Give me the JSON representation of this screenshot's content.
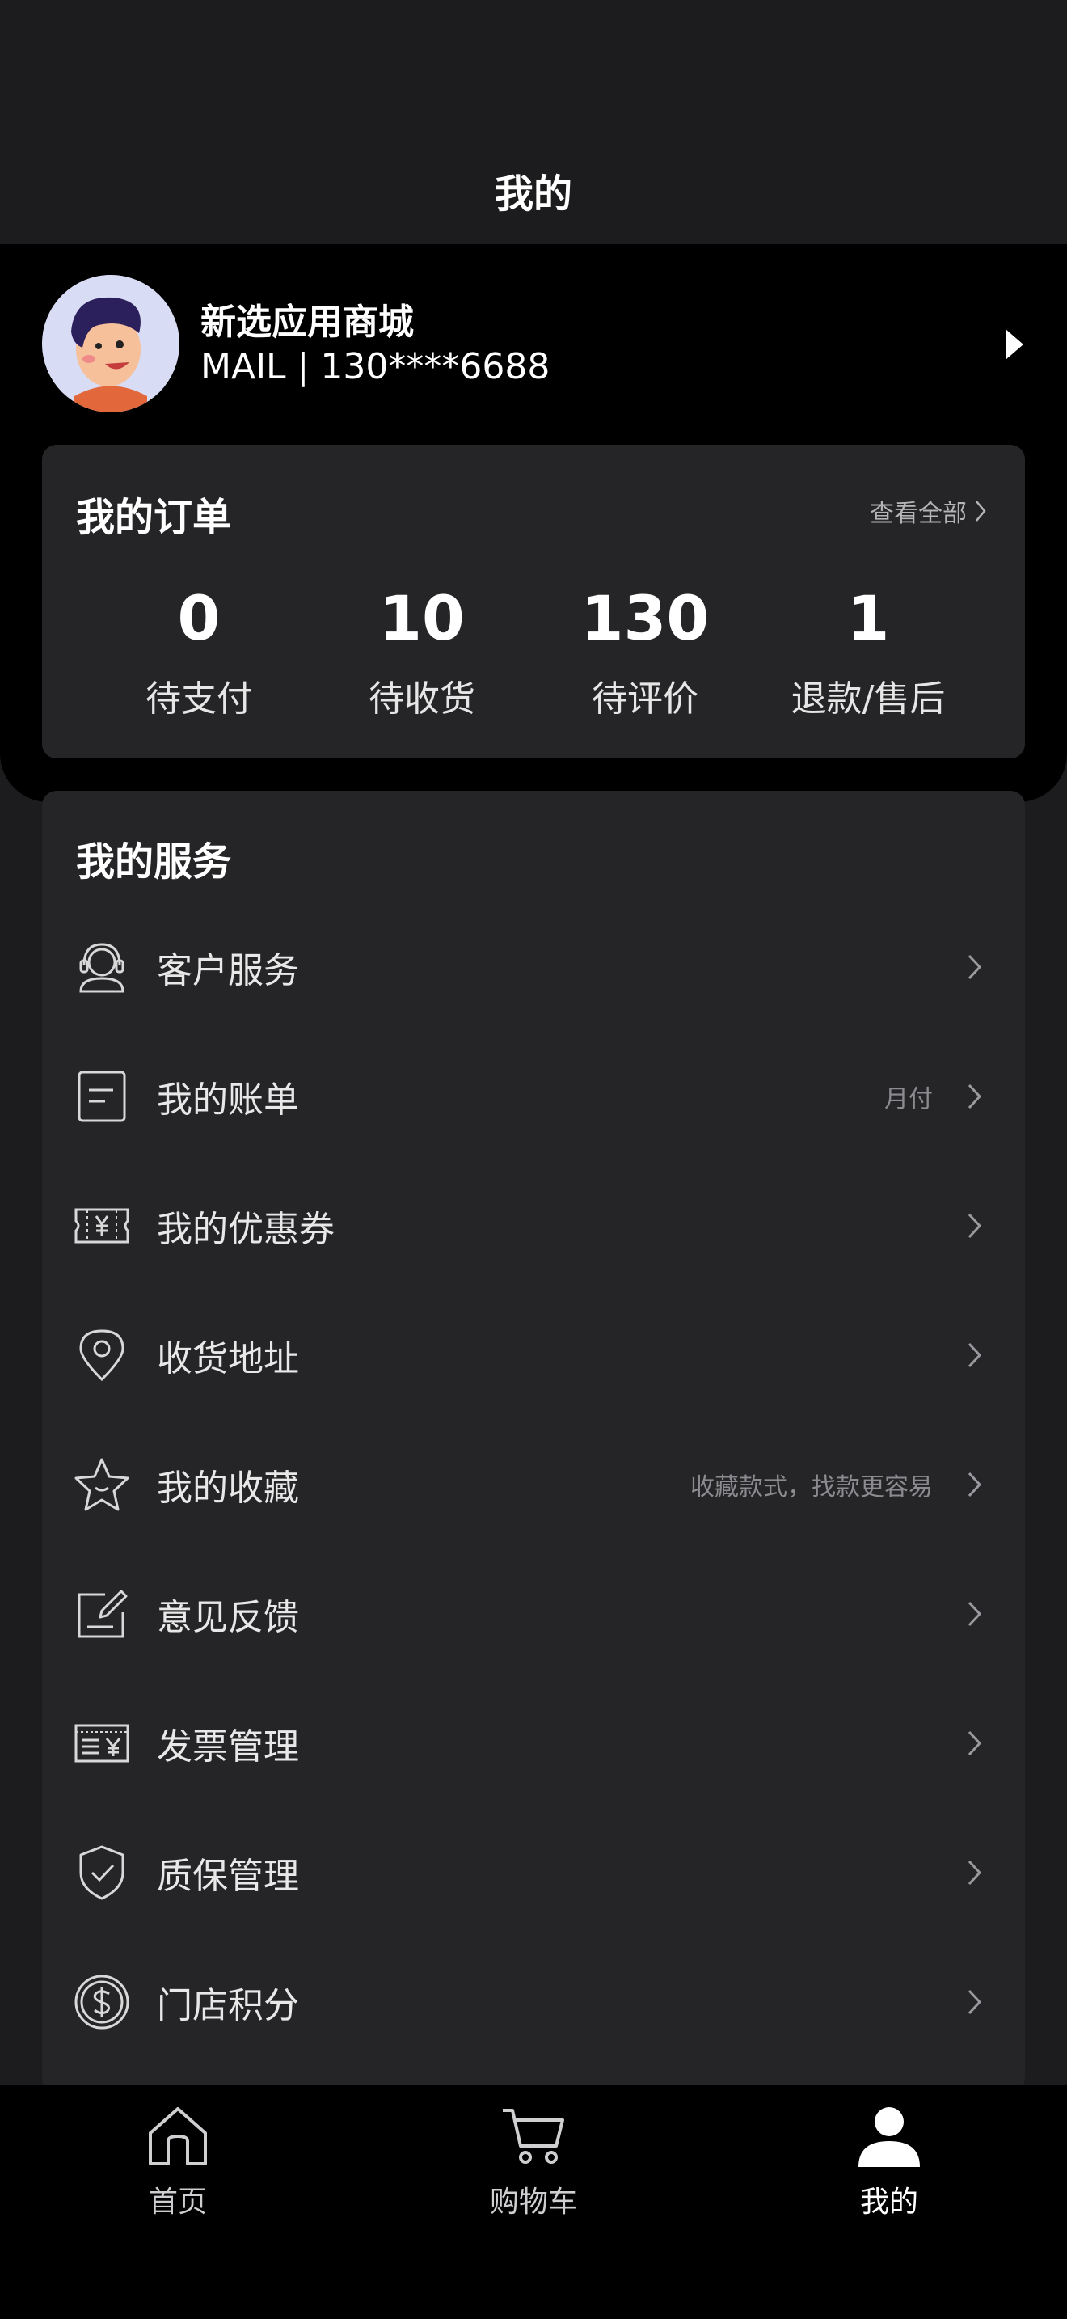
{
  "header": {
    "title": "我的"
  },
  "profile": {
    "name": "新选应用商城",
    "subtitle": "MAIL | 130****6688"
  },
  "orders": {
    "title": "我的订单",
    "view_all": "查看全部",
    "stats": [
      {
        "value": "0",
        "label": "待支付"
      },
      {
        "value": "10",
        "label": "待收货"
      },
      {
        "value": "130",
        "label": "待评价"
      },
      {
        "value": "1",
        "label": "退款/售后"
      }
    ]
  },
  "services": {
    "title": "我的服务",
    "items": [
      {
        "label": "客户服务",
        "note": "",
        "icon": "customer-service-icon"
      },
      {
        "label": "我的账单",
        "note": "月付",
        "icon": "bill-icon"
      },
      {
        "label": "我的优惠券",
        "note": "",
        "icon": "coupon-icon"
      },
      {
        "label": "收货地址",
        "note": "",
        "icon": "location-icon"
      },
      {
        "label": "我的收藏",
        "note": "收藏款式，找款更容易",
        "icon": "star-icon"
      },
      {
        "label": "意见反馈",
        "note": "",
        "icon": "feedback-icon"
      },
      {
        "label": "发票管理",
        "note": "",
        "icon": "invoice-icon"
      },
      {
        "label": "质保管理",
        "note": "",
        "icon": "shield-icon"
      },
      {
        "label": "门店积分",
        "note": "",
        "icon": "points-icon"
      }
    ]
  },
  "tabbar": {
    "items": [
      {
        "label": "首页",
        "icon": "home-icon",
        "active": false
      },
      {
        "label": "购物车",
        "icon": "cart-icon",
        "active": false
      },
      {
        "label": "我的",
        "icon": "user-icon",
        "active": true
      }
    ]
  },
  "colors": {
    "background": "#1c1c1e",
    "hero": "#000000",
    "card": "#252527",
    "text": "#ffffff",
    "muted": "#8c8c90"
  }
}
